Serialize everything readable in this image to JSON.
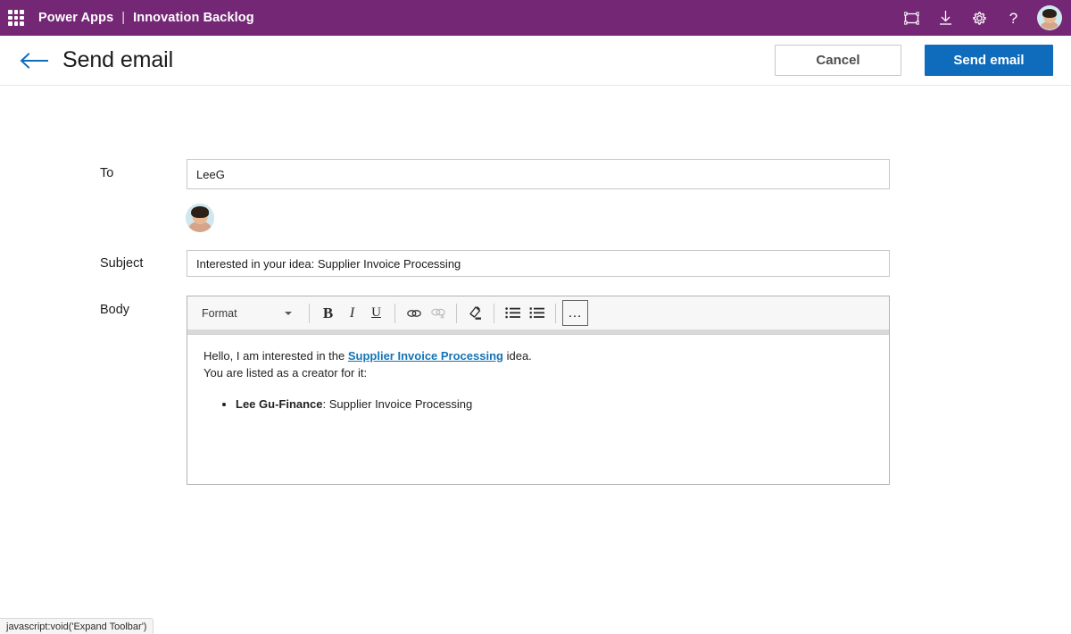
{
  "topbar": {
    "app_launcher_icon": "waffle-grid-icon",
    "brand": "Power Apps",
    "separator": "|",
    "app_name": "Innovation Backlog",
    "bg_color": "#742774",
    "icons": [
      {
        "name": "fullscreen-icon",
        "label": "Fullscreen"
      },
      {
        "name": "download-icon",
        "label": "Download"
      },
      {
        "name": "gear-icon",
        "label": "Settings"
      },
      {
        "name": "help-icon",
        "label": "Help"
      }
    ],
    "avatar": {
      "name": "user-avatar",
      "label": "Account manager"
    }
  },
  "command_bar": {
    "back_icon": "back-arrow-icon",
    "title": "Send email",
    "cancel_label": "Cancel",
    "send_label": "Send email",
    "primary_color": "#0f6cbd"
  },
  "form": {
    "to": {
      "label": "To",
      "value": "LeeG",
      "placeholder": "",
      "chip_avatar": "person-avatar"
    },
    "subject": {
      "label": "Subject",
      "value": "Interested in your idea: Supplier Invoice Processing",
      "placeholder": ""
    },
    "body": {
      "label": "Body"
    }
  },
  "editor": {
    "format_label": "Format",
    "caret_icon": "chevron-down-icon",
    "buttons": [
      {
        "name": "bold-button",
        "label": "B",
        "state": "enabled"
      },
      {
        "name": "italic-button",
        "label": "I",
        "state": "enabled"
      },
      {
        "name": "underline-button",
        "label": "U",
        "state": "enabled"
      },
      {
        "name": "insert-link-button",
        "label": "Link",
        "state": "enabled"
      },
      {
        "name": "remove-link-button",
        "label": "Unlink",
        "state": "disabled"
      },
      {
        "name": "clear-formatting-button",
        "label": "Clear formatting",
        "state": "enabled"
      },
      {
        "name": "bulleted-list-button",
        "label": "Bulleted list",
        "state": "enabled"
      },
      {
        "name": "numbered-list-button",
        "label": "Numbered list",
        "state": "enabled"
      },
      {
        "name": "expand-toolbar-button",
        "label": "…",
        "state": "focused"
      }
    ],
    "content": {
      "line1_prefix": "Hello, I am interested in the ",
      "link_text": "Supplier Invoice Processing",
      "line1_suffix": " idea.",
      "line2": "You are listed as a creator for it:",
      "list_items": [
        {
          "bold": "Lee Gu-Finance",
          "rest": ": Supplier Invoice Processing"
        }
      ],
      "link_color": "#1473b5"
    }
  },
  "statusbar": {
    "text": "javascript:void('Expand Toolbar')"
  }
}
